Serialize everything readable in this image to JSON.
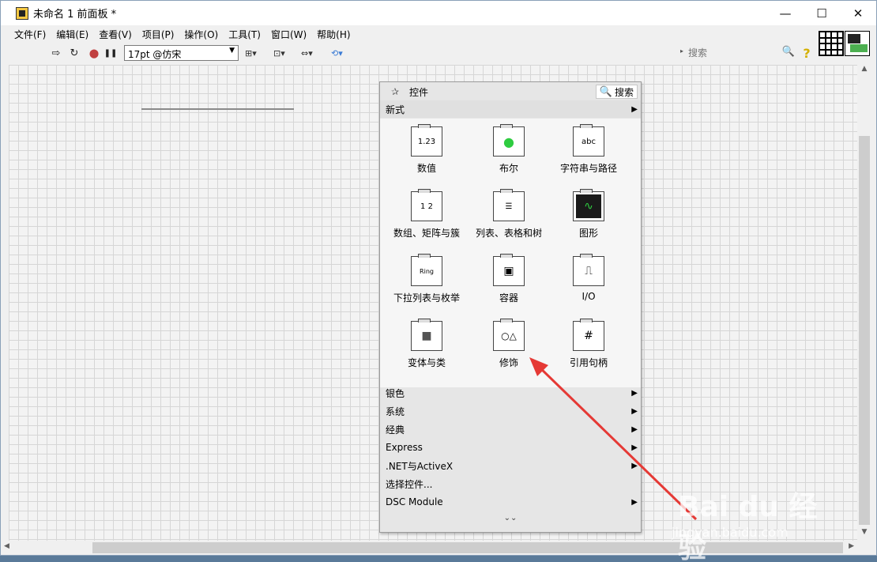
{
  "window": {
    "title": "未命名 1 前面板 *",
    "min_glyph": "—",
    "max_glyph": "☐",
    "close_glyph": "✕"
  },
  "menu": [
    "文件(F)",
    "编辑(E)",
    "查看(V)",
    "项目(P)",
    "操作(O)",
    "工具(T)",
    "窗口(W)",
    "帮助(H)"
  ],
  "toolbar": {
    "font_select": "17pt @仿宋",
    "run_glyph": "⇨",
    "run_continuous_glyph": "↻",
    "abort_glyph": "⬤",
    "pause_glyph": "❚❚",
    "align_glyph": "⊞▾",
    "distribute_glyph": "⊡▾",
    "resize_glyph": "⇔▾",
    "reorder_glyph": "⟲▾",
    "search_placeholder": "搜索",
    "search_icon": "🔍",
    "help_glyph": "?"
  },
  "palette": {
    "title": "控件",
    "pin_icon": "✰",
    "search_label": "搜索",
    "search_icon": "🔍",
    "expanded_category": "新式",
    "arrow": "▶",
    "items": [
      {
        "label": "数值",
        "glyph": "1.23"
      },
      {
        "label": "布尔",
        "glyph": "●"
      },
      {
        "label": "字符串与路径",
        "glyph": "abc"
      },
      {
        "label": "数组、矩阵与簇",
        "glyph": "1 2"
      },
      {
        "label": "列表、表格和树",
        "glyph": "☰"
      },
      {
        "label": "图形",
        "glyph": "∿"
      },
      {
        "label": "下拉列表与枚举",
        "glyph": "Ring"
      },
      {
        "label": "容器",
        "glyph": "▣"
      },
      {
        "label": "I/O",
        "glyph": "⎍"
      },
      {
        "label": "变体与类",
        "glyph": "■"
      },
      {
        "label": "修饰",
        "glyph": "○△"
      },
      {
        "label": "引用句柄",
        "glyph": "#"
      }
    ],
    "categories": [
      {
        "label": "银色",
        "arrow": true
      },
      {
        "label": "系统",
        "arrow": true
      },
      {
        "label": "经典",
        "arrow": true
      },
      {
        "label": "Express",
        "arrow": true
      },
      {
        "label": ".NET与ActiveX",
        "arrow": true
      },
      {
        "label": "选择控件...",
        "arrow": false
      },
      {
        "label": "DSC Module",
        "arrow": true
      }
    ],
    "more_glyph": "⌄⌄"
  },
  "scrollbars": {
    "up": "▲",
    "down": "▼",
    "left": "◀",
    "right": "▶"
  },
  "watermark": {
    "main": "Bai du 经验",
    "sub": "jingyan.baidu.com"
  },
  "colors": {
    "annotation_arrow": "#e53935",
    "watermark": "#ffffff"
  }
}
